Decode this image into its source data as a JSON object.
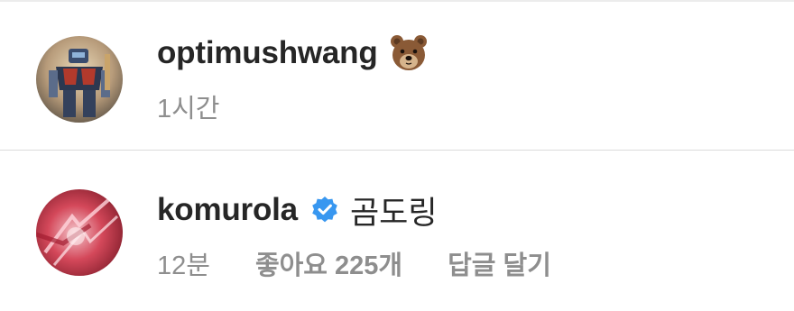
{
  "comments": [
    {
      "username": "optimushwang",
      "emoji": "bear-face",
      "text": "",
      "verified": false,
      "time": "1시간",
      "likes": "",
      "reply": ""
    },
    {
      "username": "komurola",
      "emoji": "",
      "text": "곰도링",
      "verified": true,
      "time": "12분",
      "likes": "좋아요 225개",
      "reply": "답글 달기"
    }
  ],
  "colors": {
    "primary_text": "#262626",
    "secondary_text": "#8e8e8e",
    "verified_blue": "#3897f0",
    "divider": "#dbdbdb"
  }
}
